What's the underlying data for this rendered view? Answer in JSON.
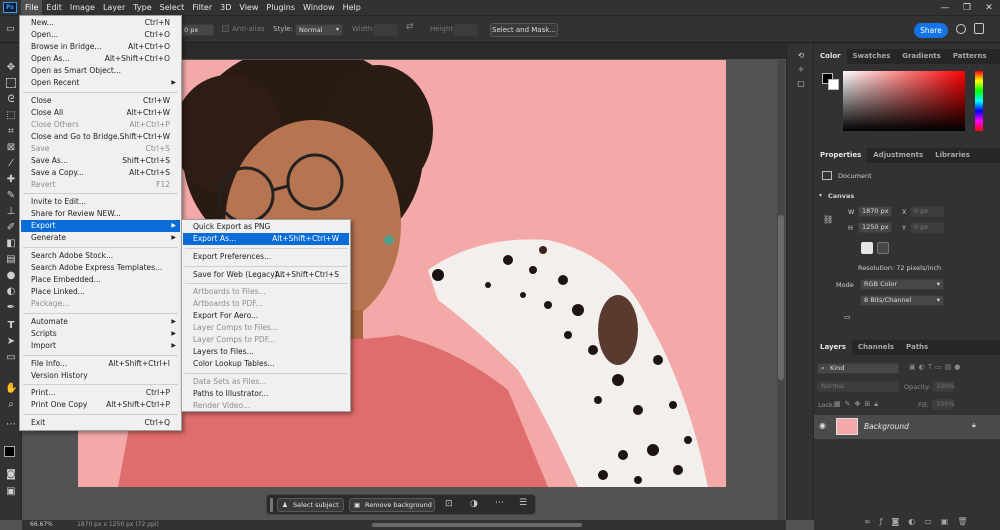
{
  "menubar": {
    "logo": "Ps",
    "items": [
      "File",
      "Edit",
      "Image",
      "Layer",
      "Type",
      "Select",
      "Filter",
      "3D",
      "View",
      "Plugins",
      "Window",
      "Help"
    ]
  },
  "window_controls": [
    "—",
    "❐",
    "✕"
  ],
  "options": {
    "feather_value": "0 px",
    "anti_alias": "Anti-alias",
    "style_label": "Style:",
    "style_value": "Normal",
    "width_label": "Width:",
    "height_label": "Height:",
    "select_mask": "Select and Mask...",
    "share": "Share"
  },
  "file_menu": [
    {
      "label": "New...",
      "shortcut": "Ctrl+N"
    },
    {
      "label": "Open...",
      "shortcut": "Ctrl+O"
    },
    {
      "label": "Browse in Bridge...",
      "shortcut": "Alt+Ctrl+O"
    },
    {
      "label": "Open As...",
      "shortcut": "Alt+Shift+Ctrl+O"
    },
    {
      "label": "Open as Smart Object...",
      "shortcut": ""
    },
    {
      "label": "Open Recent",
      "shortcut": "",
      "submenu": true
    },
    {
      "label": "Close",
      "shortcut": "Ctrl+W"
    },
    {
      "label": "Close All",
      "shortcut": "Alt+Ctrl+W"
    },
    {
      "label": "Close Others",
      "shortcut": "Alt+Ctrl+P",
      "disabled": true
    },
    {
      "label": "Close and Go to Bridge...",
      "shortcut": "Shift+Ctrl+W"
    },
    {
      "label": "Save",
      "shortcut": "Ctrl+S",
      "disabled": true
    },
    {
      "label": "Save As...",
      "shortcut": "Shift+Ctrl+S"
    },
    {
      "label": "Save a Copy...",
      "shortcut": "Alt+Ctrl+S"
    },
    {
      "label": "Revert",
      "shortcut": "F12",
      "disabled": true
    },
    {
      "label": "Invite to Edit...",
      "shortcut": ""
    },
    {
      "label": "Share for Review NEW...",
      "shortcut": ""
    },
    {
      "label": "Export",
      "shortcut": "",
      "submenu": true,
      "highlighted": true
    },
    {
      "label": "Generate",
      "shortcut": "",
      "submenu": true
    },
    {
      "label": "Search Adobe Stock...",
      "shortcut": ""
    },
    {
      "label": "Search Adobe Express Templates...",
      "shortcut": ""
    },
    {
      "label": "Place Embedded...",
      "shortcut": ""
    },
    {
      "label": "Place Linked...",
      "shortcut": ""
    },
    {
      "label": "Package...",
      "shortcut": "",
      "disabled": true
    },
    {
      "label": "Automate",
      "shortcut": "",
      "submenu": true
    },
    {
      "label": "Scripts",
      "shortcut": "",
      "submenu": true
    },
    {
      "label": "Import",
      "shortcut": "",
      "submenu": true
    },
    {
      "label": "File Info...",
      "shortcut": "Alt+Shift+Ctrl+I"
    },
    {
      "label": "Version History",
      "shortcut": ""
    },
    {
      "label": "Print...",
      "shortcut": "Ctrl+P"
    },
    {
      "label": "Print One Copy",
      "shortcut": "Alt+Shift+Ctrl+P"
    },
    {
      "label": "Exit",
      "shortcut": "Ctrl+Q"
    }
  ],
  "export_menu": [
    {
      "label": "Quick Export as PNG",
      "shortcut": ""
    },
    {
      "label": "Export As...",
      "shortcut": "Alt+Shift+Ctrl+W",
      "highlighted": true
    },
    {
      "label": "Export Preferences...",
      "shortcut": ""
    },
    {
      "label": "Save for Web (Legacy)...",
      "shortcut": "Alt+Shift+Ctrl+S"
    },
    {
      "label": "Artboards to Files...",
      "shortcut": "",
      "disabled": true
    },
    {
      "label": "Artboards to PDF...",
      "shortcut": "",
      "disabled": true
    },
    {
      "label": "Export For Aero...",
      "shortcut": ""
    },
    {
      "label": "Layer Comps to Files...",
      "shortcut": "",
      "disabled": true
    },
    {
      "label": "Layer Comps to PDF...",
      "shortcut": "",
      "disabled": true
    },
    {
      "label": "Layers to Files...",
      "shortcut": ""
    },
    {
      "label": "Color Lookup Tables...",
      "shortcut": ""
    },
    {
      "label": "Data Sets as Files...",
      "shortcut": "",
      "disabled": true
    },
    {
      "label": "Paths to Illustrator...",
      "shortcut": ""
    },
    {
      "label": "Render Video...",
      "shortcut": "",
      "disabled": true
    }
  ],
  "color_panel": {
    "tabs": [
      "Color",
      "Swatches",
      "Gradients",
      "Patterns"
    ]
  },
  "properties_panel": {
    "tabs": [
      "Properties",
      "Adjustments",
      "Libraries"
    ],
    "document_label": "Document",
    "canvas_label": "Canvas",
    "w_label": "W",
    "w_value": "1870 px",
    "h_label": "H",
    "h_value": "1250 px",
    "x_label": "X",
    "x_value": "0 px",
    "y_label": "Y",
    "y_value": "0 px",
    "resolution": "Resolution: 72 pixels/inch",
    "mode_label": "Mode",
    "mode_value": "RGB Color",
    "depth_value": "8 Bits/Channel"
  },
  "layers_panel": {
    "tabs": [
      "Layers",
      "Channels",
      "Paths"
    ],
    "kind_placeholder": "Kind",
    "blend_mode": "Normal",
    "opacity_label": "Opacity:",
    "opacity_value": "100%",
    "lock_label": "Lock:",
    "fill_label": "Fill:",
    "fill_value": "100%",
    "layer_name": "Background"
  },
  "context_bar": {
    "select_subject": "Select subject",
    "remove_background": "Remove background"
  },
  "status": {
    "zoom": "66.67%",
    "info": "1870 px x 1250 px (72 ppi)"
  },
  "colors": {
    "accent": "#1473e6",
    "highlight": "#0a6cd6",
    "canvas_bg": "#f4a9a9",
    "panel": "#323232"
  }
}
